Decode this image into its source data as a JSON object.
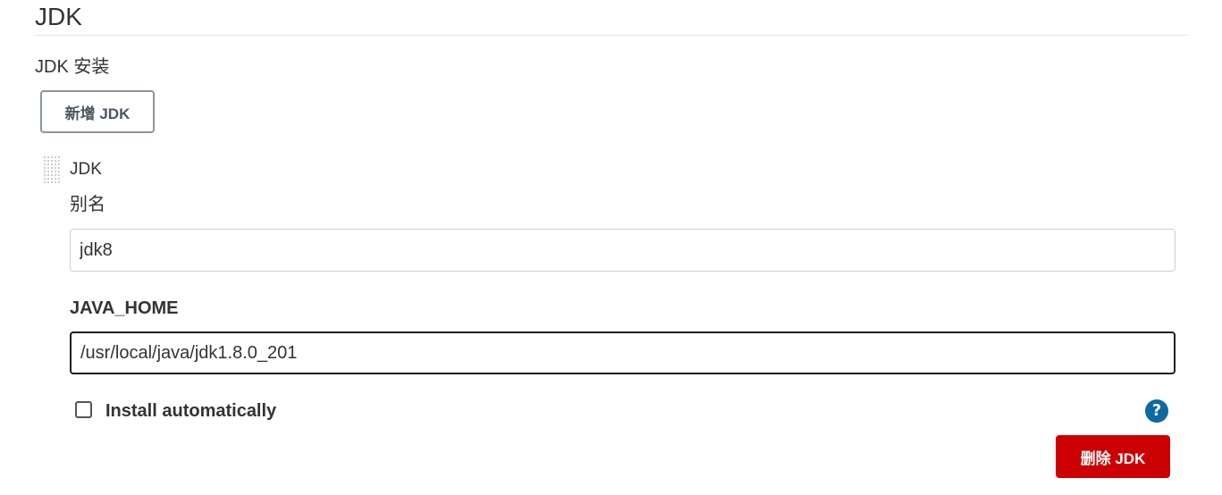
{
  "section": {
    "title": "JDK",
    "installations_label": "JDK 安装"
  },
  "add_button": {
    "label": "新增 JDK"
  },
  "entry": {
    "title": "JDK",
    "alias_label": "别名",
    "alias_value": "jdk8",
    "java_home_label": "JAVA_HOME",
    "java_home_value": "/usr/local/java/jdk1.8.0_201",
    "install_automatically_label": "Install automatically",
    "install_automatically_checked": false,
    "help_icon": "?",
    "delete_button_label": "删除 JDK"
  },
  "colors": {
    "delete_button": "#cc0003",
    "help_icon": "#0b6aa2",
    "add_button_border": "#8a95a0"
  },
  "icons": {
    "drag_handle": "drag-handle-icon",
    "help": "help-icon"
  }
}
